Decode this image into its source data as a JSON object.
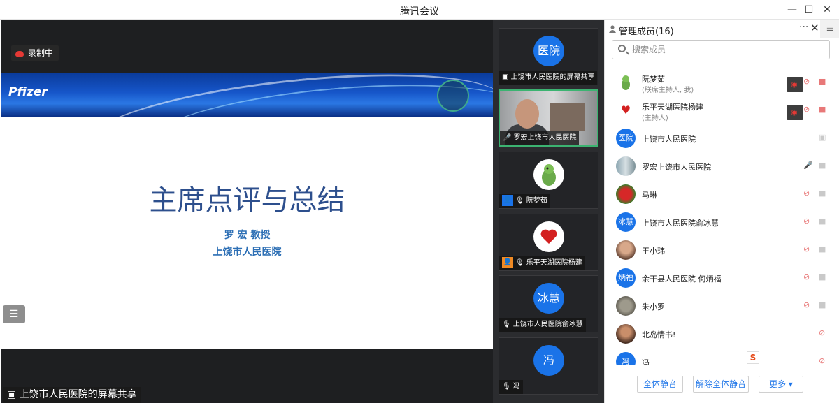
{
  "window": {
    "title": "腾讯会议",
    "minimize": "—",
    "maximize": "☐",
    "close": "✕"
  },
  "main": {
    "recording_label": "录制中",
    "share_label": "上饶市人民医院的屏幕共享",
    "menu_glyph": "☰",
    "slide": {
      "logo_text": "Pfizer",
      "heading": "主席点评与总结",
      "speaker": "罗 宏 教授",
      "hospital": "上饶市人民医院"
    }
  },
  "video_strip": {
    "tiles": [
      {
        "avatar": "医院",
        "caption": "上饶市人民医院的屏幕共享",
        "icon": "▣"
      },
      {
        "caption": "罗宏上饶市人民医院",
        "icon": "🎤"
      },
      {
        "caption": "阮梦茹",
        "icon": "🎙"
      },
      {
        "caption": "乐平天湖医院杨建",
        "icon": "🎙"
      },
      {
        "avatar": "冰慧",
        "caption": "上饶市人民医院俞冰慧",
        "icon": "🎙"
      },
      {
        "avatar": "冯",
        "caption": "冯",
        "icon": "🎙"
      }
    ]
  },
  "members_panel": {
    "title": "管理成员(16)",
    "more": "···",
    "close": "✕",
    "menu": "≡",
    "search_placeholder": "搜索成员",
    "members": [
      {
        "name": "阮梦茹",
        "role": "(联席主持人, 我)",
        "avatar": "🦖"
      },
      {
        "name": "乐平天湖医院杨建",
        "role": "(主持人)",
        "avatar": "❤"
      },
      {
        "name": "上饶市人民医院",
        "avatar": "医院"
      },
      {
        "name": "罗宏上饶市人民医院",
        "avatar": ""
      },
      {
        "name": "马琳",
        "avatar": ""
      },
      {
        "name": "上饶市人民医院俞冰慧",
        "avatar": "冰慧"
      },
      {
        "name": "王小玮",
        "avatar": ""
      },
      {
        "name": "余干县人民医院 何炳福",
        "avatar": "炳福"
      },
      {
        "name": "朱小罗",
        "avatar": ""
      },
      {
        "name": "北岛情书!",
        "avatar": ""
      },
      {
        "name": "冯",
        "avatar": "冯"
      }
    ],
    "footer": {
      "mute_all": "全体静音",
      "unmute_all": "解除全体静音",
      "more": "更多 ▾"
    }
  }
}
